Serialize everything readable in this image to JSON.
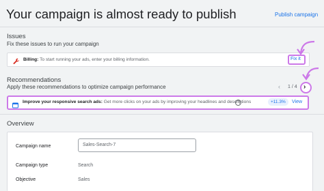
{
  "header": {
    "title": "Your campaign is almost ready to publish",
    "publish_label": "Publish campaign"
  },
  "issues": {
    "title": "Issues",
    "subtitle": "Fix these issues to run your campaign",
    "item": {
      "icon": "wrench-icon",
      "label": "Billing:",
      "text": "To start running your ads, enter your billing information.",
      "action": "Fix it"
    }
  },
  "recommendations": {
    "title": "Recommendations",
    "subtitle": "Apply these recommendations to optimize campaign performance",
    "pager": "1 / 4",
    "item": {
      "icon": "ad-icon",
      "label": "Improve your responsive search ads:",
      "text": "Get more clicks on your ads by improving your headlines and descriptions",
      "badge": "+11.3%",
      "action": "View"
    }
  },
  "overview": {
    "title": "Overview",
    "rows": [
      {
        "label": "Campaign name",
        "value": "Sales-Search-7"
      },
      {
        "label": "Campaign type",
        "value": "Search"
      },
      {
        "label": "Objective",
        "value": "Sales"
      }
    ]
  },
  "colors": {
    "accent": "#1a73e8",
    "highlight": "#cc78e8",
    "warning": "#d93025"
  }
}
